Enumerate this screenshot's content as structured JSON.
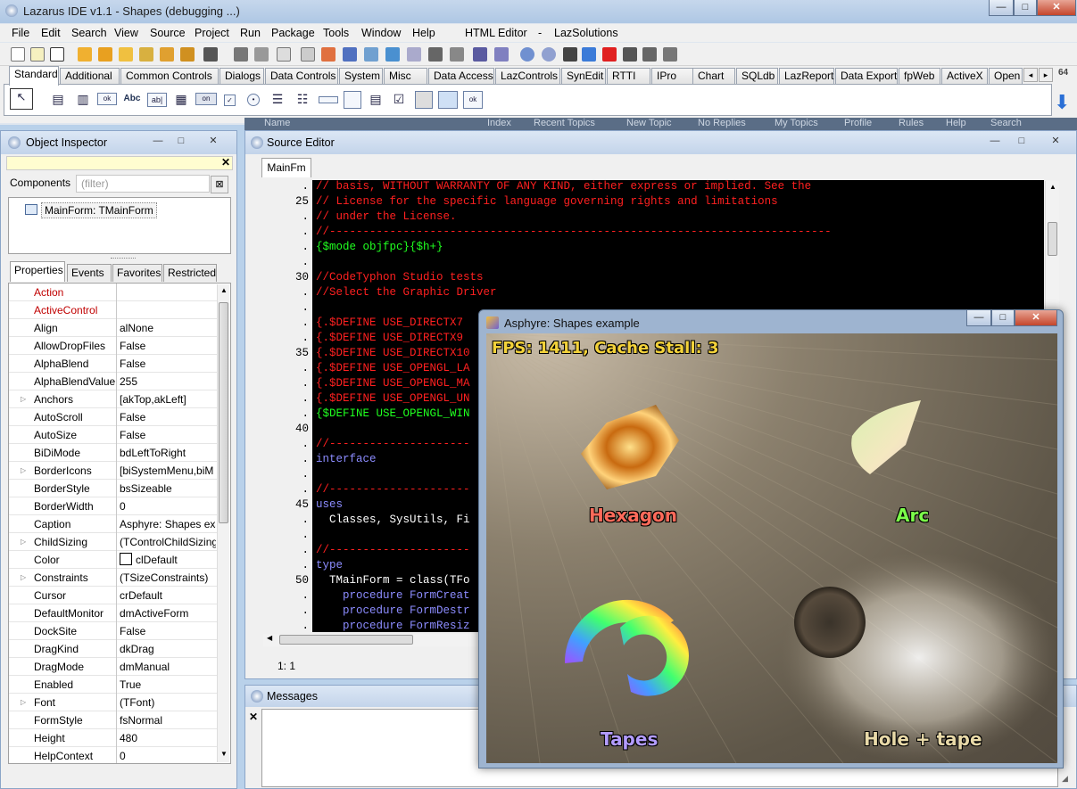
{
  "window": {
    "title": "Lazarus IDE v1.1 - Shapes (debugging ...)"
  },
  "menu": [
    "File",
    "Edit",
    "Search",
    "View",
    "Source",
    "Project",
    "Run",
    "Package",
    "Tools",
    "Window",
    "Help",
    "HTML Editor",
    "-",
    "LazSolutions"
  ],
  "palette": {
    "tabs": [
      "Standard",
      "Additional",
      "Common Controls",
      "Dialogs",
      "Data Controls",
      "System",
      "Misc",
      "Data Access",
      "LazControls",
      "SynEdit",
      "RTTI",
      "IPro",
      "Chart",
      "SQLdb",
      "LazReport",
      "Data Export",
      "fpWeb",
      "ActiveX",
      "Open"
    ],
    "side_label": "64",
    "behind_text": [
      "Name",
      "Index",
      "Recent Topics",
      "New Topic",
      "No Replies",
      "My Topics",
      "Profile",
      "Rules",
      "Help",
      "Search"
    ]
  },
  "object_inspector": {
    "title": "Object Inspector",
    "components_label": "Components",
    "filter_placeholder": "(filter)",
    "tree_item": "MainForm: TMainForm",
    "tabs": [
      "Properties",
      "Events",
      "Favorites",
      "Restricted"
    ],
    "properties": [
      {
        "name": "Action",
        "value": "",
        "red": true
      },
      {
        "name": "ActiveControl",
        "value": "",
        "red": true
      },
      {
        "name": "Align",
        "value": "alNone"
      },
      {
        "name": "AllowDropFiles",
        "value": "False"
      },
      {
        "name": "AlphaBlend",
        "value": "False"
      },
      {
        "name": "AlphaBlendValue",
        "value": "255"
      },
      {
        "name": "Anchors",
        "value": "[akTop,akLeft]",
        "expand": true
      },
      {
        "name": "AutoScroll",
        "value": "False"
      },
      {
        "name": "AutoSize",
        "value": "False"
      },
      {
        "name": "BiDiMode",
        "value": "bdLeftToRight"
      },
      {
        "name": "BorderIcons",
        "value": "[biSystemMenu,biM",
        "expand": true
      },
      {
        "name": "BorderStyle",
        "value": "bsSizeable"
      },
      {
        "name": "BorderWidth",
        "value": "0"
      },
      {
        "name": "Caption",
        "value": "Asphyre: Shapes exa"
      },
      {
        "name": "ChildSizing",
        "value": "(TControlChildSizing",
        "expand": true
      },
      {
        "name": "Color",
        "value": "clDefault",
        "swatch": true
      },
      {
        "name": "Constraints",
        "value": "(TSizeConstraints)",
        "expand": true
      },
      {
        "name": "Cursor",
        "value": "crDefault"
      },
      {
        "name": "DefaultMonitor",
        "value": "dmActiveForm"
      },
      {
        "name": "DockSite",
        "value": "False"
      },
      {
        "name": "DragKind",
        "value": "dkDrag"
      },
      {
        "name": "DragMode",
        "value": "dmManual"
      },
      {
        "name": "Enabled",
        "value": "True"
      },
      {
        "name": "Font",
        "value": "(TFont)",
        "expand": true
      },
      {
        "name": "FormStyle",
        "value": "fsNormal"
      },
      {
        "name": "Height",
        "value": "480"
      },
      {
        "name": "HelpContext",
        "value": "0"
      }
    ]
  },
  "source_editor": {
    "title": "Source Editor",
    "tab": "MainFm",
    "status": "1:  1",
    "line_numbers": [
      {
        "n": ".",
        "row": 0
      },
      {
        "n": "25",
        "row": 1
      },
      {
        "n": ".",
        "row": 2
      },
      {
        "n": ".",
        "row": 3
      },
      {
        "n": ".",
        "row": 4
      },
      {
        "n": ".",
        "row": 5
      },
      {
        "n": "30",
        "row": 6
      },
      {
        "n": ".",
        "row": 7
      },
      {
        "n": ".",
        "row": 8
      },
      {
        "n": ".",
        "row": 9
      },
      {
        "n": ".",
        "row": 10
      },
      {
        "n": "35",
        "row": 11
      },
      {
        "n": ".",
        "row": 12
      },
      {
        "n": ".",
        "row": 13
      },
      {
        "n": ".",
        "row": 14
      },
      {
        "n": ".",
        "row": 15
      },
      {
        "n": "40",
        "row": 16
      },
      {
        "n": ".",
        "row": 17
      },
      {
        "n": ".",
        "row": 18
      },
      {
        "n": ".",
        "row": 19
      },
      {
        "n": ".",
        "row": 20
      },
      {
        "n": "45",
        "row": 21
      },
      {
        "n": ".",
        "row": 22
      },
      {
        "n": ".",
        "row": 23
      },
      {
        "n": ".",
        "row": 24
      },
      {
        "n": ".",
        "row": 25
      },
      {
        "n": "50",
        "row": 26
      },
      {
        "n": ".",
        "row": 27
      },
      {
        "n": ".",
        "row": 28
      },
      {
        "n": ".",
        "row": 29
      }
    ],
    "code": [
      {
        "row": 0,
        "text": "// basis, WITHOUT WARRANTY OF ANY KIND, either express or implied. See the",
        "color": "#ff2020"
      },
      {
        "row": 1,
        "text": "// License for the specific language governing rights and limitations",
        "color": "#ff2020"
      },
      {
        "row": 2,
        "text": "// under the License.",
        "color": "#ff2020"
      },
      {
        "row": 3,
        "text": "//---------------------------------------------------------------------------",
        "color": "#ff2020"
      },
      {
        "row": 4,
        "text": "{$mode objfpc}{$h+}",
        "color": "#20ff20"
      },
      {
        "row": 6,
        "text": "//CodeTyphon Studio tests",
        "color": "#ff2020"
      },
      {
        "row": 7,
        "text": "//Select the Graphic Driver",
        "color": "#ff2020"
      },
      {
        "row": 9,
        "text": "{.$DEFINE USE_DIRECTX7",
        "color": "#ff2020"
      },
      {
        "row": 10,
        "text": "{.$DEFINE USE_DIRECTX9",
        "color": "#ff2020"
      },
      {
        "row": 11,
        "text": "{.$DEFINE USE_DIRECTX10",
        "color": "#ff2020"
      },
      {
        "row": 12,
        "text": "{.$DEFINE USE_OPENGL_LA",
        "color": "#ff2020"
      },
      {
        "row": 13,
        "text": "{.$DEFINE USE_OPENGL_MA",
        "color": "#ff2020"
      },
      {
        "row": 14,
        "text": "{.$DEFINE USE_OPENGL_UN",
        "color": "#ff2020"
      },
      {
        "row": 15,
        "text": "{$DEFINE USE_OPENGL_WIN",
        "color": "#20ff20"
      },
      {
        "row": 17,
        "text": "//---------------------",
        "color": "#ff2020"
      },
      {
        "row": 18,
        "text": "interface",
        "color": "#8c8cff"
      },
      {
        "row": 20,
        "text": "//---------------------",
        "color": "#ff2020"
      },
      {
        "row": 21,
        "text": "uses",
        "color": "#8c8cff"
      },
      {
        "row": 22,
        "text": "  Classes, SysUtils, Fi",
        "color": "#ffffff"
      },
      {
        "row": 24,
        "text": "//---------------------",
        "color": "#ff2020"
      },
      {
        "row": 25,
        "text": "type",
        "color": "#8c8cff"
      },
      {
        "row": 26,
        "text": "  TMainForm = class(TFo",
        "color": "#ffffff"
      },
      {
        "row": 27,
        "text": "    procedure FormCreat",
        "color": "#8c8cff"
      },
      {
        "row": 28,
        "text": "    procedure FormDestr",
        "color": "#8c8cff"
      },
      {
        "row": 29,
        "text": "    procedure FormResiz",
        "color": "#8c8cff"
      }
    ]
  },
  "messages": {
    "title": "Messages"
  },
  "asphyre": {
    "title": "Asphyre: Shapes example",
    "fps_text": "FPS: 1411, Cache Stall: 3",
    "labels": {
      "hexagon": "Hexagon",
      "arc": "Arc",
      "tapes": "Tapes",
      "hole": "Hole + tape"
    }
  },
  "colors": {
    "hexagon_label": "#ff6a5a",
    "arc_label": "#7cff4a",
    "tapes_label": "#b39cff",
    "hole_label": "#e8d9a8",
    "fps": "#f3d23a"
  }
}
